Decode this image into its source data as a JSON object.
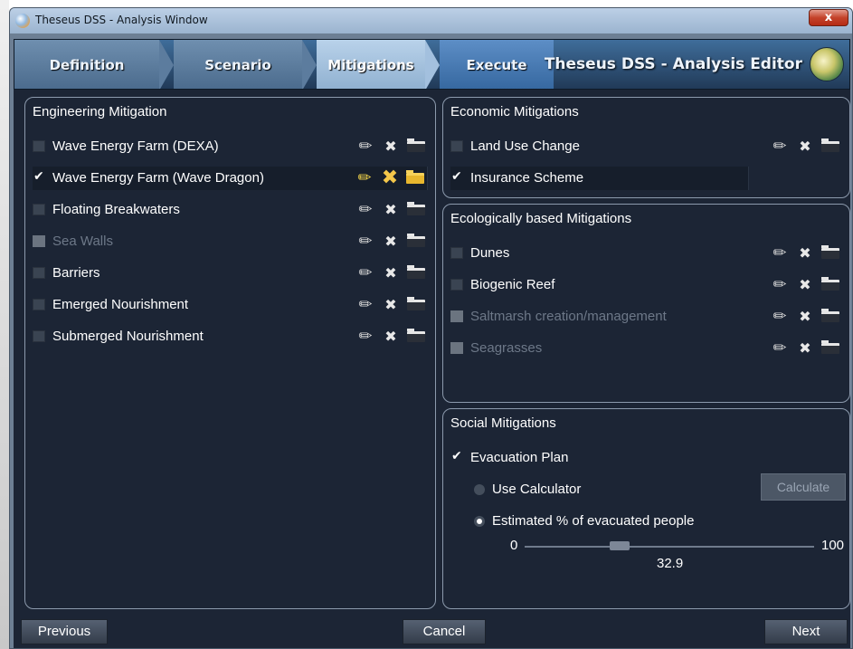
{
  "window": {
    "title": "Theseus DSS - Analysis Window",
    "close_glyph": "x"
  },
  "steps": [
    {
      "label": "Definition",
      "state": "done"
    },
    {
      "label": "Scenario",
      "state": "done"
    },
    {
      "label": "Mitigations",
      "state": "active"
    },
    {
      "label": "Execute",
      "state": "next"
    }
  ],
  "editor_title": "Theseus DSS - Analysis Editor",
  "engineering": {
    "title": "Engineering Mitigation",
    "items": [
      {
        "label": "Wave Energy Farm (DEXA)",
        "checked": false,
        "enabled": true
      },
      {
        "label": "Wave Energy Farm (Wave Dragon)",
        "checked": true,
        "enabled": true
      },
      {
        "label": "Floating Breakwaters",
        "checked": false,
        "enabled": true
      },
      {
        "label": "Sea Walls",
        "checked": false,
        "enabled": false
      },
      {
        "label": "Barriers",
        "checked": false,
        "enabled": true
      },
      {
        "label": "Emerged Nourishment",
        "checked": false,
        "enabled": true
      },
      {
        "label": "Submerged Nourishment",
        "checked": false,
        "enabled": true
      }
    ]
  },
  "economic": {
    "title": "Economic Mitigations",
    "items": [
      {
        "label": "Land Use Change",
        "checked": false,
        "enabled": true
      },
      {
        "label": "Insurance Scheme",
        "checked": true,
        "enabled": true
      }
    ]
  },
  "ecological": {
    "title": "Ecologically based Mitigations",
    "items": [
      {
        "label": "Dunes",
        "checked": false,
        "enabled": true
      },
      {
        "label": "Biogenic Reef",
        "checked": false,
        "enabled": true
      },
      {
        "label": "Saltmarsh creation/management",
        "checked": false,
        "enabled": false
      },
      {
        "label": "Seagrasses",
        "checked": false,
        "enabled": false
      }
    ]
  },
  "social": {
    "title": "Social Mitigations",
    "evacuation_label": "Evacuation Plan",
    "evacuation_checked": true,
    "use_calculator_label": "Use Calculator",
    "calculate_button": "Calculate",
    "estimated_label": "Estimated % of evacuated people",
    "slider": {
      "min_label": "0",
      "max_label": "100",
      "value_label": "32.9",
      "value": 32.9
    }
  },
  "icons": {
    "edit": "pencil-icon",
    "delete": "delete-icon",
    "open": "folder-icon"
  },
  "footer": {
    "previous": "Previous",
    "cancel": "Cancel",
    "next": "Next"
  }
}
